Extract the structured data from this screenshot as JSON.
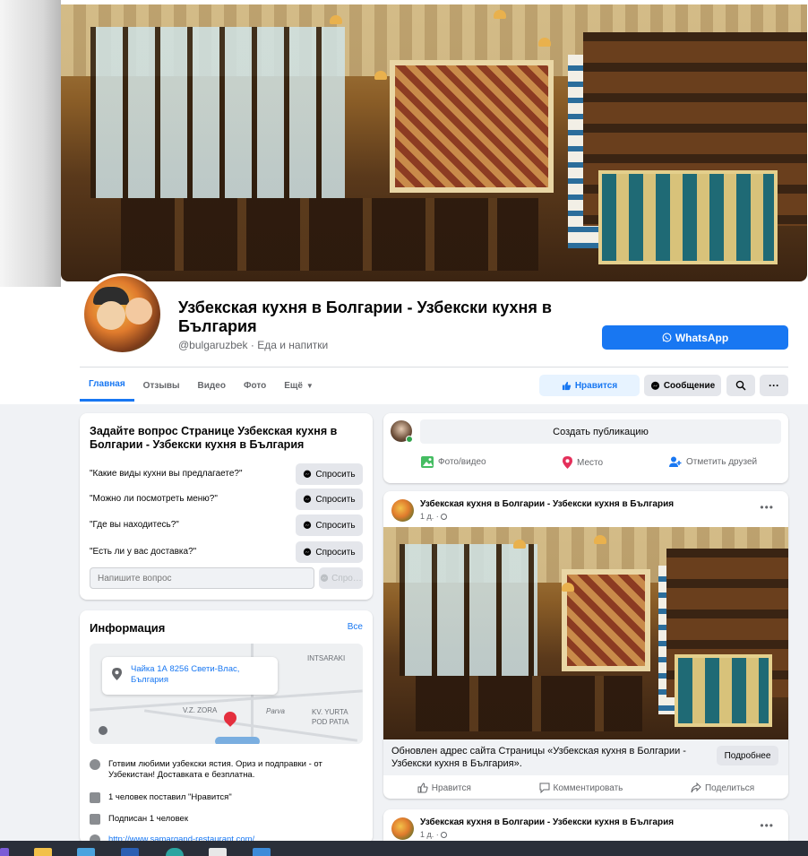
{
  "page": {
    "name": "Узбекская кухня в Болгарии - Узбекски кухня в България",
    "handle_category": "@bulgaruzbek · Еда и напитки",
    "whatsapp_label": "WhatsApp"
  },
  "tabs": [
    {
      "label": "Главная",
      "active": true
    },
    {
      "label": "Отзывы"
    },
    {
      "label": "Видео"
    },
    {
      "label": "Фото"
    },
    {
      "label": "Ещё"
    }
  ],
  "actions": {
    "like": "Нравится",
    "message": "Сообщение",
    "more": "···"
  },
  "ask": {
    "title": "Задайте вопрос Странице Узбекская кухня в Болгарии - Узбекски кухня в България",
    "questions": [
      "\"Какие виды кухни вы предлагаете?\"",
      "\"Можно ли посмотреть меню?\"",
      "\"Где вы находитесь?\"",
      "\"Есть ли у вас доставка?\""
    ],
    "ask_button": "Спросить",
    "input_placeholder": "Напишите вопрос",
    "send_button": "Спро…"
  },
  "info": {
    "title": "Информация",
    "see_all": "Все",
    "address_line1": "Чайка 1А 8256 Свети-Влас,",
    "address_line2": "България",
    "map_labels": {
      "intsaraki": "INTSARAKI",
      "vzzora": "V.Z. ZORA",
      "parva": "Parva",
      "kv_yurta": "KV. YURTA",
      "pod_patia": "POD PATIA"
    },
    "description": "Готвим любими узбекски ястия. Ориз и подправки - от Узбекистан! Доставката е безплатна.",
    "likes": "1 человек поставил \"Нравится\"",
    "follows": "Подписан 1 человек",
    "website": "http://www.samarqand-restaurant.com/"
  },
  "composer": {
    "prompt": "Создать публикацию",
    "photo_video": "Фото/видео",
    "place": "Место",
    "tag_friends": "Отметить друзей"
  },
  "posts": [
    {
      "author": "Узбекская кухня в Болгарии - Узбекски кухня в България",
      "time": "1 д. ·",
      "link_text": "Обновлен адрес сайта Страницы «Узбекская кухня в Болгарии - Узбекски кухня в България».",
      "link_button": "Подробнее",
      "like": "Нравится",
      "comment": "Комментировать",
      "share": "Поделиться"
    },
    {
      "author": "Узбекская кухня в Болгарии - Узбекски кухня в България",
      "time": "1 д. ·"
    }
  ],
  "colors": {
    "accent": "#1877f2",
    "background": "#f0f2f5",
    "online": "#31a24c"
  }
}
